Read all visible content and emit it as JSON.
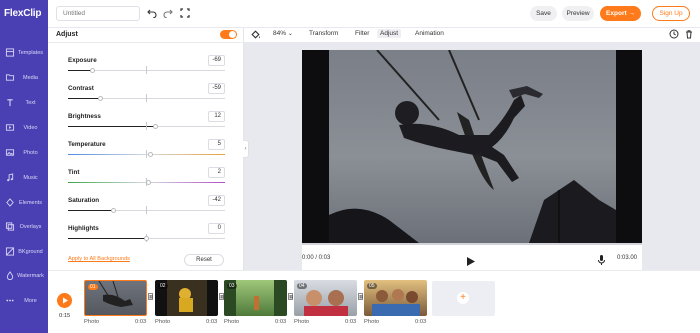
{
  "app": {
    "logo_text": "FlexClip"
  },
  "sidebar": {
    "items": [
      {
        "label": "Templates",
        "icon": "templates-icon"
      },
      {
        "label": "Media",
        "icon": "folder-icon"
      },
      {
        "label": "Text",
        "icon": "text-icon"
      },
      {
        "label": "Video",
        "icon": "video-icon"
      },
      {
        "label": "Photo",
        "icon": "photo-icon"
      },
      {
        "label": "Music",
        "icon": "music-icon"
      },
      {
        "label": "Elements",
        "icon": "elements-icon"
      },
      {
        "label": "Overlays",
        "icon": "overlays-icon"
      },
      {
        "label": "BKground",
        "icon": "background-icon"
      },
      {
        "label": "Watermark",
        "icon": "watermark-icon"
      },
      {
        "label": "More",
        "icon": "more-icon"
      }
    ]
  },
  "topbar": {
    "title_placeholder": "Untitled",
    "save_label": "Save",
    "preview_label": "Preview",
    "export_label": "Export",
    "signup_label": "Sign Up"
  },
  "adjust_panel": {
    "title": "Adjust",
    "enabled": true,
    "sliders": [
      {
        "label": "Exposure",
        "value": "-69",
        "fraction": 0.155
      },
      {
        "label": "Contrast",
        "value": "-59",
        "fraction": 0.205
      },
      {
        "label": "Brightness",
        "value": "12",
        "fraction": 0.56
      },
      {
        "label": "Temperature",
        "value": "5",
        "fraction": 0.525
      },
      {
        "label": "Tint",
        "value": "2",
        "fraction": 0.51
      },
      {
        "label": "Saturation",
        "value": "-42",
        "fraction": 0.29
      },
      {
        "label": "Highlights",
        "value": "0",
        "fraction": 0.5
      }
    ],
    "apply_all_label": "Apply to All Backgrounds",
    "reset_label": "Reset"
  },
  "edit_toolbar": {
    "zoom": "84%",
    "items": [
      "Transform",
      "Filter",
      "Adjust",
      "Animation"
    ],
    "active": "Adjust"
  },
  "player": {
    "current_time": "0:00 / 0:03",
    "end_time": "0:03.00"
  },
  "timeline": {
    "total_time": "0:15",
    "clips": [
      {
        "num": "01",
        "type": "Photo",
        "duration": "0:03"
      },
      {
        "num": "02",
        "type": "Photo",
        "duration": "0:03"
      },
      {
        "num": "03",
        "type": "Photo",
        "duration": "0:03"
      },
      {
        "num": "04",
        "type": "Photo",
        "duration": "0:03"
      },
      {
        "num": "05",
        "type": "Photo",
        "duration": "0:03"
      }
    ]
  },
  "colors": {
    "accent": "#ff7a1a",
    "sidebar": "#4a3fb3"
  }
}
